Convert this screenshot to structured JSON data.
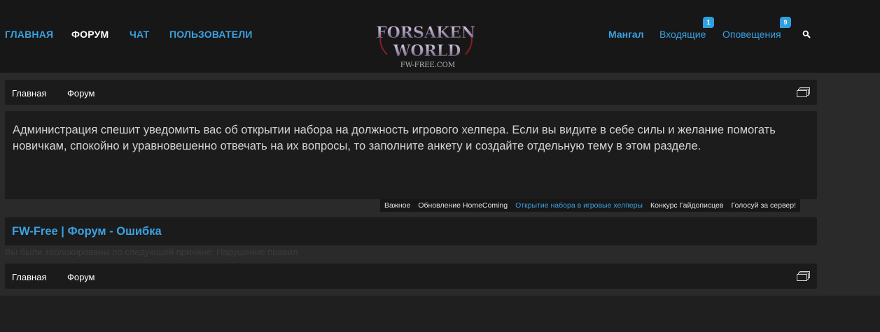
{
  "nav": {
    "home": "ГЛАВНАЯ",
    "forum": "ФОРУМ",
    "chat": "ЧАТ",
    "users": "ПОЛЬЗОВАТЕЛИ"
  },
  "logo": {
    "line1": "FORSAKEN",
    "line2": "WORLD",
    "line3": "FW-FREE.COM"
  },
  "user_nav": {
    "username": "Мангал",
    "inbox_label": "Входящие",
    "inbox_count": "1",
    "alerts_label": "Оповещения",
    "alerts_count": "9",
    "search_icon": "search-icon"
  },
  "breadcrumb_top": {
    "home": "Главная",
    "forum": "Форум"
  },
  "announcement": {
    "text": "Администрация спешит уведомить вас об открытии набора на должность игрового хелпера. Если вы видите в себе силы и желание помогать новичкам, спокойно и уравновешенно отвечать на их вопросы, то заполните анкету и создайте отдельную тему в этом разделе."
  },
  "notice_tabs": [
    "Важное",
    "Обновление HomeComing",
    "Открытие набора в игровые хелперы",
    "Конкурс Гайдописцев",
    "Голосуй за сервер!"
  ],
  "page": {
    "title": "FW-Free | Форум - Ошибка",
    "error_text": "Вы были заблокированы по следующей причине: Нарушение правил"
  },
  "breadcrumb_bottom": {
    "home": "Главная",
    "forum": "Форум"
  },
  "colors": {
    "accent": "#3aa1e0",
    "header_bg": "#171717",
    "page_bg": "#2a2a2b",
    "panel_bg": "#1b1b1c"
  }
}
